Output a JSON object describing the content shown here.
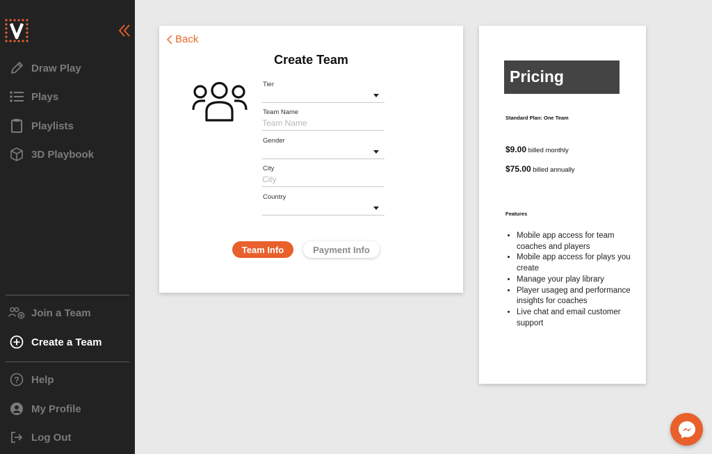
{
  "sidebar": {
    "items": [
      {
        "label": "Draw Play",
        "icon": "pencil-icon"
      },
      {
        "label": "Plays",
        "icon": "list-icon"
      },
      {
        "label": "Playlists",
        "icon": "clipboard-icon"
      },
      {
        "label": "3D Playbook",
        "icon": "cube-icon"
      }
    ],
    "team_items": [
      {
        "label": "Join a Team",
        "icon": "add-user-icon"
      },
      {
        "label": "Create a Team",
        "icon": "plus-circle-icon",
        "active": true
      }
    ],
    "bottom_items": [
      {
        "label": "Help",
        "icon": "question-icon"
      },
      {
        "label": "My Profile",
        "icon": "user-icon"
      },
      {
        "label": "Log Out",
        "icon": "logout-icon"
      }
    ]
  },
  "team_form": {
    "back_label": "Back",
    "title": "Create Team",
    "fields": {
      "tier": {
        "label": "Tier",
        "value": ""
      },
      "team_name": {
        "label": "Team Name",
        "placeholder": "Team Name"
      },
      "gender": {
        "label": "Gender",
        "value": ""
      },
      "city": {
        "label": "City",
        "placeholder": "City"
      },
      "country": {
        "label": "Country",
        "value": ""
      }
    },
    "tabs": {
      "team_info": "Team Info",
      "payment_info": "Payment Info"
    }
  },
  "pricing": {
    "title": "Pricing",
    "plan": "Standard Plan: One Team",
    "monthly_price": "$9.00",
    "monthly_suffix": " billed monthly",
    "annual_price": "$75.00",
    "annual_suffix": " billed annually",
    "features_label": "Features",
    "features": [
      "Mobile app access for team coaches and players",
      "Mobile app access for plays you create",
      "Manage your play library",
      "Player usageg and performance insights for coaches",
      "Live chat and email customer support"
    ]
  },
  "colors": {
    "accent": "#e8602c",
    "sidebar_bg": "#222222",
    "page_bg": "#e9e9e9"
  }
}
